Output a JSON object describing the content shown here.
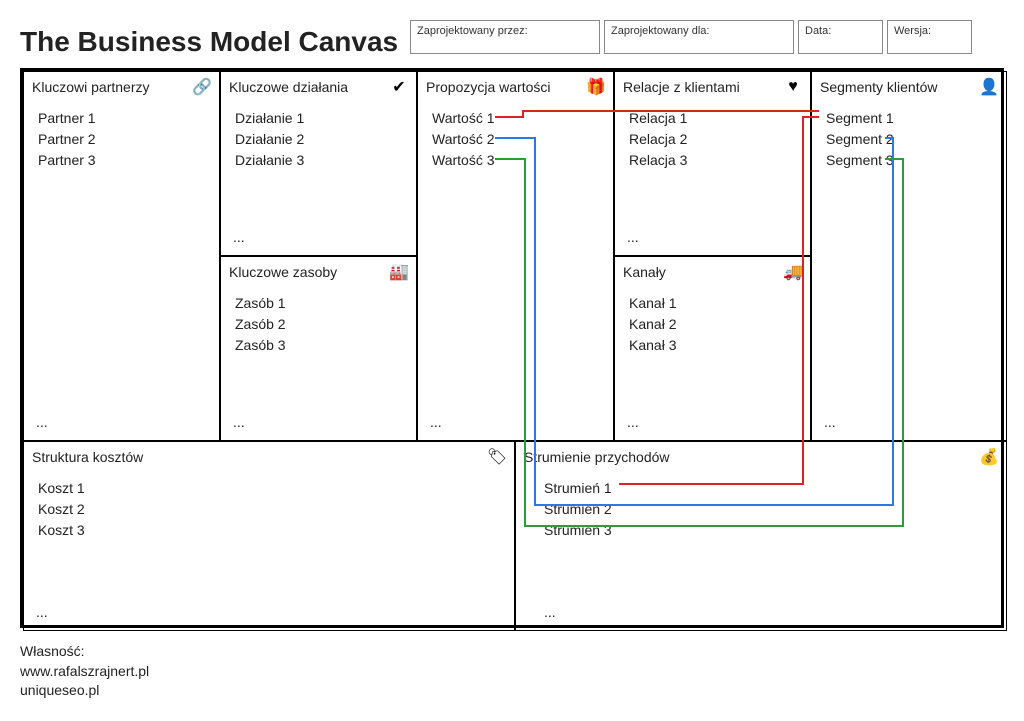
{
  "title": "The Business Model Canvas",
  "meta": {
    "designedBy": "Zaprojektowany przez:",
    "designedFor": "Zaprojektowany dla:",
    "date": "Data:",
    "version": "Wersja:"
  },
  "blocks": {
    "partners": {
      "title": "Kluczowi partnerzy",
      "items": [
        "Partner 1",
        "Partner 2",
        "Partner 3"
      ],
      "more": "..."
    },
    "activities": {
      "title": "Kluczowe działania",
      "items": [
        "Działanie 1",
        "Działanie 2",
        "Działanie 3"
      ],
      "more": "..."
    },
    "resources": {
      "title": "Kluczowe zasoby",
      "items": [
        "Zasób 1",
        "Zasób 2",
        "Zasób 3"
      ],
      "more": "..."
    },
    "value": {
      "title": "Propozycja wartości",
      "items": [
        "Wartość 1",
        "Wartość 2",
        "Wartość 3"
      ],
      "more": "..."
    },
    "relations": {
      "title": "Relacje z klientami",
      "items": [
        "Relacja 1",
        "Relacja 2",
        "Relacja 3"
      ],
      "more": "..."
    },
    "channels": {
      "title": "Kanały",
      "items": [
        "Kanał 1",
        "Kanał 2",
        "Kanał 3"
      ],
      "more": "..."
    },
    "segments": {
      "title": "Segmenty klientów",
      "items": [
        "Segment 1",
        "Segment 2",
        "Segment 3"
      ],
      "more": "..."
    },
    "costs": {
      "title": "Struktura kosztów",
      "items": [
        "Koszt 1",
        "Koszt 2",
        "Koszt 3"
      ],
      "more": "..."
    },
    "revenue": {
      "title": "Strumienie przychodów",
      "items": [
        "Strumień 1",
        "Strumień 2",
        "Strumień 3"
      ],
      "more": "..."
    }
  },
  "colors": {
    "red": "#d22",
    "blue": "#2a7ae2",
    "green": "#2a9d3a"
  },
  "footer": {
    "owner": "Własność:",
    "line1": "www.rafalszrajnert.pl",
    "line2": "uniqueseo.pl"
  }
}
